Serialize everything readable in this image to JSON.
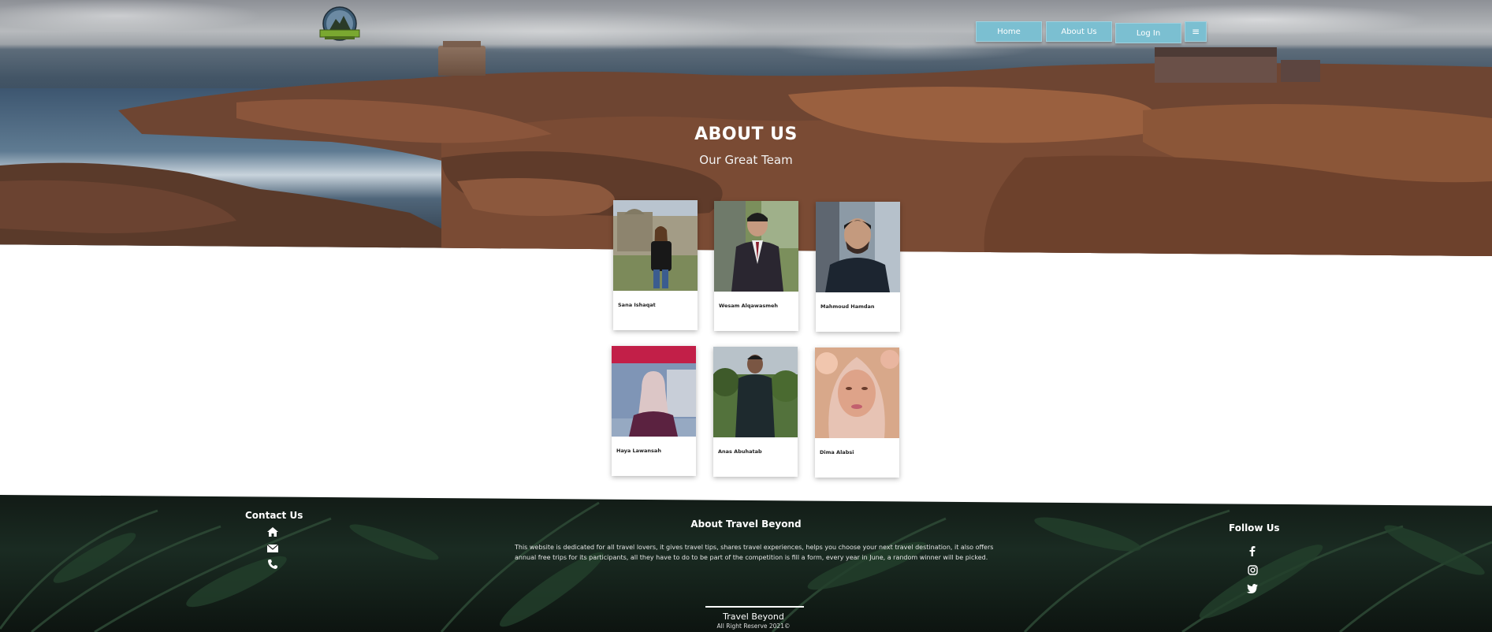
{
  "header": {
    "logo_alt": "Travel Beyond logo",
    "nav": {
      "home": "Home",
      "about": "About Us",
      "login": "Log In",
      "menu_icon": "hamburger-icon"
    }
  },
  "hero": {
    "title": "ABOUT US",
    "subtitle": "Our Great Team"
  },
  "team": [
    {
      "name": "Sana Ishaqat"
    },
    {
      "name": "Wesam Alqawasmeh"
    },
    {
      "name": "Mahmoud Hamdan"
    },
    {
      "name": "Haya Lawansah"
    },
    {
      "name": "Anas Abuhatab"
    },
    {
      "name": "Dima Alabsi"
    }
  ],
  "footer": {
    "contact": {
      "title": "Contact Us",
      "icons": [
        "home-icon",
        "mail-icon",
        "phone-icon"
      ]
    },
    "about": {
      "title": "About Travel Beyond",
      "line1": "This website is dedicated for all travel lovers, it gives travel tips, shares travel experiences, helps you choose your next travel destination, it also offers",
      "line2": "annual free trips for its participants, all they have to do to be part of the competition is fill a form, every year in June, a random winner will be picked."
    },
    "follow": {
      "title": "Follow Us",
      "icons": [
        "facebook-icon",
        "instagram-icon",
        "twitter-icon"
      ]
    },
    "brand": "Travel Beyond",
    "copyright": "All Right Reserve 2021©"
  },
  "colors": {
    "nav_button": "#7bbfd1",
    "footer_bg": "#121b16",
    "text_light": "#ffffff"
  }
}
